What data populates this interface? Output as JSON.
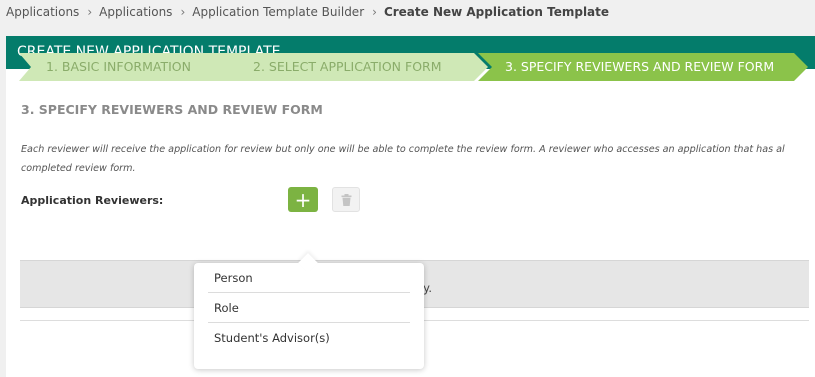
{
  "breadcrumb": {
    "items": [
      "Applications",
      "Applications",
      "Application Template Builder"
    ],
    "current": "Create New Application Template"
  },
  "header": {
    "title": "CREATE NEW APPLICATION TEMPLATE"
  },
  "steps": [
    {
      "label": "1. BASIC INFORMATION",
      "state": "done"
    },
    {
      "label": "2. SELECT APPLICATION FORM",
      "state": "done"
    },
    {
      "label": "3. SPECIFY REVIEWERS AND REVIEW FORM",
      "state": "active"
    }
  ],
  "section": {
    "title": "3. SPECIFY REVIEWERS AND REVIEW FORM",
    "description_line1": "Each reviewer will receive the application for review but only one will be able to complete the review form. A reviewer who accesses an application that has al",
    "description_line2": "completed review form."
  },
  "reviewers": {
    "label": "Application Reviewers:",
    "add_symbol": "+",
    "empty_text": "splay."
  },
  "dropdown": {
    "items": [
      "Person",
      "Role",
      "Student's Advisor(s)"
    ]
  },
  "colors": {
    "header_bg": "#047c6b",
    "step_done": "#cfe8b6",
    "step_active": "#8bc34a",
    "add_button": "#7cb342"
  },
  "icons": {
    "breadcrumb_separator": "chevron-right-icon",
    "add": "plus-icon",
    "delete": "trash-icon"
  }
}
